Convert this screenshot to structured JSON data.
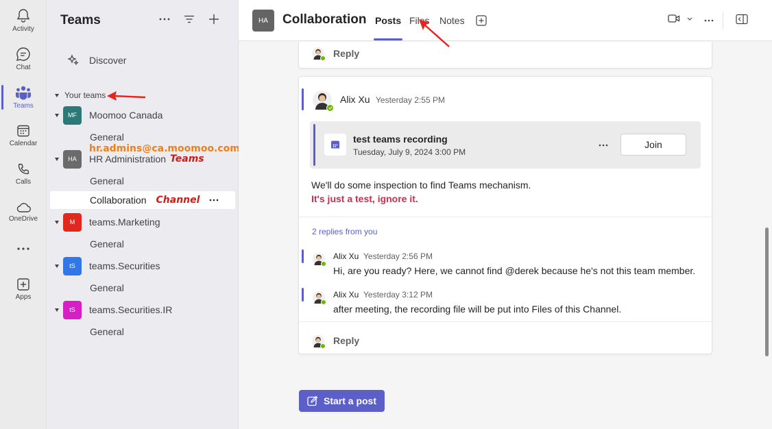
{
  "rail": {
    "items": [
      {
        "label": "Activity",
        "icon": "bell-icon"
      },
      {
        "label": "Chat",
        "icon": "chat-icon"
      },
      {
        "label": "Teams",
        "icon": "teams-icon",
        "active": true
      },
      {
        "label": "Calendar",
        "icon": "calendar-icon"
      },
      {
        "label": "Calls",
        "icon": "phone-icon"
      },
      {
        "label": "OneDrive",
        "icon": "cloud-icon"
      },
      {
        "label": "",
        "icon": "more-icon"
      },
      {
        "label": "Apps",
        "icon": "plus-box-icon"
      }
    ]
  },
  "panel": {
    "title": "Teams",
    "discover": "Discover",
    "your_teams": "Your teams",
    "teams": [
      {
        "initials": "MF",
        "name": "Moomoo Canada",
        "color": "#2b7a78",
        "channels": [
          "General"
        ]
      },
      {
        "initials": "HA",
        "name": "HR Administration",
        "color": "#6b6b6b",
        "channels": [
          "General",
          "Collaboration"
        ]
      },
      {
        "initials": "M",
        "name": "teams.Marketing",
        "color": "#e0281f",
        "channels": [
          "General"
        ]
      },
      {
        "initials": "tS",
        "name": "teams.Securities",
        "color": "#3277e8",
        "channels": [
          "General"
        ]
      },
      {
        "initials": "tS",
        "name": "teams.Securities.IR",
        "color": "#d61fc4",
        "channels": [
          "General"
        ]
      }
    ],
    "annotations": {
      "email": "hr.admins@ca.moomoo.com",
      "teams_label": "Teams",
      "channel_label": "Channel"
    }
  },
  "header": {
    "avatar": "HA",
    "title": "Collaboration",
    "tabs": [
      "Posts",
      "Files",
      "Notes"
    ],
    "active_tab": "Posts"
  },
  "thread": {
    "reply_label": "Reply",
    "post": {
      "author": "Alix Xu",
      "time": "Yesterday 2:55 PM",
      "meeting_title": "test teams recording",
      "meeting_time": "Tuesday, July 9, 2024 3:00 PM",
      "join_label": "Join",
      "body": "We'll do some inspection to find Teams mechanism.",
      "body_bold": "It's just a test, ignore it.",
      "replies_link": "2 replies from you"
    },
    "replies": [
      {
        "author": "Alix Xu",
        "time": "Yesterday 2:56 PM",
        "text": "Hi, are you ready? Here, we cannot find @derek because he's not this team member."
      },
      {
        "author": "Alix Xu",
        "time": "Yesterday 3:12 PM",
        "text": "after meeting, the recording file will be put into Files of this Channel."
      }
    ]
  },
  "start_post_label": "Start a post",
  "colors": {
    "accent": "#5b5fc7",
    "annotation_red": "#d01a1a",
    "annotation_orange": "#f07f15"
  }
}
